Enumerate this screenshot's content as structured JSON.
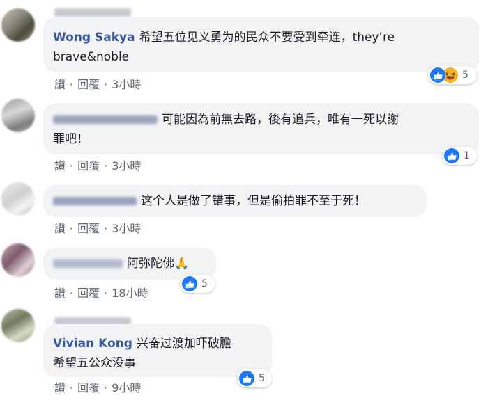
{
  "actions": {
    "like": "讚",
    "reply": "回覆",
    "separator": "·"
  },
  "comments": [
    {
      "author": "Wong Sakya",
      "text": "希望五位见义勇为的民众不要受到牵连，they're brave&noble",
      "line1": "希望五位见义勇为的民众不要受到牵连，they’re",
      "line2": "brave&noble",
      "time": "3小時",
      "reaction_count": "5",
      "reactions": [
        "like-icon",
        "haha-icon"
      ]
    },
    {
      "author": "",
      "line1": "可能因為前無去路，後有追兵，唯有一死以謝",
      "line2": "罪吧！",
      "time": "3小時",
      "reaction_count": "1",
      "reactions": [
        "like-icon"
      ]
    },
    {
      "author": "",
      "line1": "这个人是做了错事，但是偷拍罪不至于死！",
      "time": "3小時"
    },
    {
      "author": "",
      "line1": "阿弥陀佛🙏",
      "time": "18小時",
      "reaction_count": "5",
      "reactions": [
        "like-icon"
      ]
    },
    {
      "author": "Vivian Kong",
      "line1": "兴奋过渡加吓破膽",
      "line2": "希望五公众没事",
      "time": "9小時",
      "reaction_count": "5",
      "reactions": [
        "like-icon"
      ]
    }
  ],
  "colors": {
    "author": "#385898",
    "bubble": "#f2f3f5",
    "like": "#2078f4",
    "meta": "#606770"
  }
}
